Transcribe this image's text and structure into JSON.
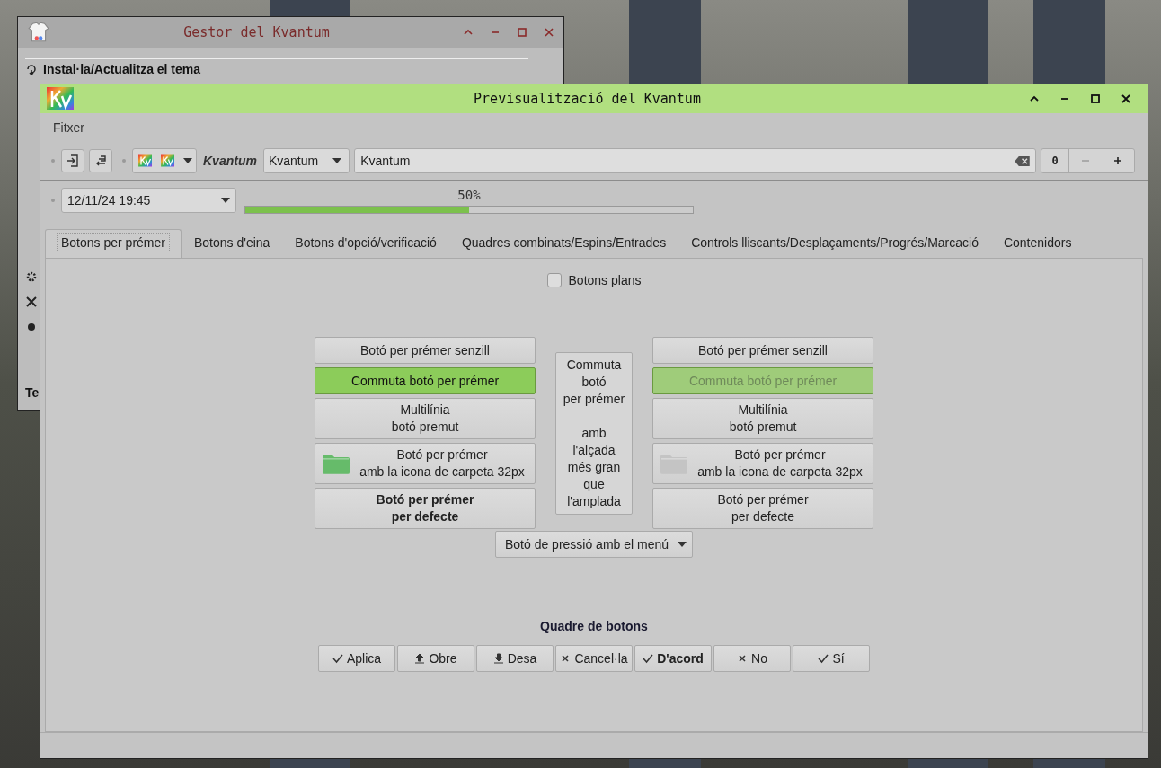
{
  "back_window": {
    "title": "Gestor del Kvantum",
    "tab": "Instal·la/Actualitza el tema",
    "cut_label": "Te"
  },
  "window": {
    "title": "Previsualització del Kvantum",
    "menu": [
      "Fitxer"
    ],
    "toolbar": {
      "label": "Kvantum",
      "combo": "Kvantum",
      "field_value": "Kvantum",
      "spin_value": "0"
    },
    "date_field": "12/11/24 19:45",
    "progress": {
      "reading": "50%",
      "level": 0.5
    },
    "tabs": [
      {
        "label": "Botons per prémer",
        "selected": true
      },
      {
        "label": "Botons d'eina",
        "selected": false
      },
      {
        "label": "Botons d'opció/verificació",
        "selected": false
      },
      {
        "label": "Quadres combinats/Espins/Entrades",
        "selected": false
      },
      {
        "label": "Controls lliscants/Desplaçaments/Progrés/Marcació",
        "selected": false
      },
      {
        "label": "Contenidors",
        "selected": false
      }
    ],
    "flat_checkbox": {
      "label": "Botons plans",
      "checked": false
    },
    "left_buttons": [
      {
        "kind": "plain",
        "lines": [
          "Botó per prémer senzill"
        ],
        "bold": false
      },
      {
        "kind": "toggle",
        "lines": [
          "Commuta botó per prémer"
        ],
        "bold": false,
        "checked": true,
        "disabled": false
      },
      {
        "kind": "plain",
        "lines": [
          "Multilínia",
          "botó premut"
        ],
        "bold": false
      },
      {
        "kind": "icon",
        "lines": [
          "Botó per prémer",
          "amb la icona de carpeta 32px"
        ],
        "bold": false,
        "color": "#66bb6a"
      },
      {
        "kind": "plain",
        "lines": [
          "Botó per prémer",
          "per defecte"
        ],
        "bold": true
      }
    ],
    "center_button": {
      "top_lines": [
        "Commuta",
        "botó",
        "per prémer"
      ],
      "bottom_lines": [
        "amb",
        "l'alçada",
        "més gran",
        "que",
        "l'amplada"
      ]
    },
    "right_buttons": [
      {
        "kind": "plain",
        "lines": [
          "Botó per prémer senzill"
        ],
        "bold": false
      },
      {
        "kind": "toggle",
        "lines": [
          "Commuta botó per prémer"
        ],
        "bold": false,
        "checked": true,
        "disabled": true
      },
      {
        "kind": "plain",
        "lines": [
          "Multilínia",
          "botó premut"
        ],
        "bold": false
      },
      {
        "kind": "icon",
        "lines": [
          "Botó per prémer",
          "amb la icona de carpeta 32px"
        ],
        "bold": false,
        "color": "#c4c4c4"
      },
      {
        "kind": "plain",
        "lines": [
          "Botó per prémer",
          "per defecte"
        ],
        "bold": false
      }
    ],
    "menu_button": "Botó de pressió amb el menú",
    "button_box": {
      "title": "Quadre de botons",
      "buttons": [
        {
          "label": "Aplica",
          "kind": "check",
          "bold": false
        },
        {
          "label": "Obre",
          "kind": "upload",
          "bold": false
        },
        {
          "label": "Desa",
          "kind": "download",
          "bold": false
        },
        {
          "label": "Cancel·la",
          "kind": "cross",
          "bold": false
        },
        {
          "label": "D'acord",
          "kind": "check",
          "bold": true
        },
        {
          "label": "No",
          "kind": "cross",
          "bold": false
        },
        {
          "label": "Sí",
          "kind": "check",
          "bold": false
        }
      ]
    }
  }
}
